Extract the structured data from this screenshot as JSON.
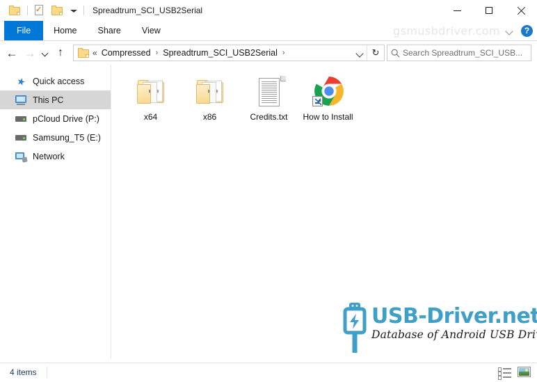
{
  "window": {
    "title": "Spreadtrum_SCI_USB2Serial",
    "quick_access": {
      "folder_icon": "folder-icon",
      "properties_icon": "properties-icon",
      "new_folder_icon": "new-folder-icon",
      "customize_icon": "customize-quick-access-icon"
    },
    "controls": {
      "minimize": "minimize-icon",
      "maximize": "maximize-icon",
      "close": "close-icon"
    }
  },
  "ribbon": {
    "tabs": [
      {
        "label": "File",
        "active": true
      },
      {
        "label": "Home",
        "active": false
      },
      {
        "label": "Share",
        "active": false
      },
      {
        "label": "View",
        "active": false
      }
    ],
    "watermark": "gsmusbdriver.com",
    "collapse_icon": "chevron-down-icon",
    "help_label": "?"
  },
  "navigation": {
    "back_icon": "←",
    "forward_icon": "→",
    "recent_icon": "chevron-down-icon",
    "up_icon": "↑",
    "refresh_icon": "↻",
    "address": {
      "folder_icon": "folder-icon",
      "overflow": "«",
      "crumbs": [
        "Compressed",
        "Spreadtrum_SCI_USB2Serial"
      ],
      "separator": "›",
      "trailing_separator": "›",
      "dropdown_icon": "chevron-down-icon"
    },
    "search": {
      "placeholder": "Search Spreadtrum_SCI_USB...",
      "icon": "search-icon"
    }
  },
  "sidebar": {
    "items": [
      {
        "label": "Quick access",
        "icon": "star-icon",
        "selected": false
      },
      {
        "label": "This PC",
        "icon": "computer-icon",
        "selected": true
      },
      {
        "label": "pCloud Drive (P:)",
        "icon": "drive-icon",
        "selected": false
      },
      {
        "label": "Samsung_T5 (E:)",
        "icon": "drive-icon",
        "selected": false
      },
      {
        "label": "Network",
        "icon": "network-icon",
        "selected": false
      }
    ]
  },
  "files": [
    {
      "name": "x64",
      "type": "folder"
    },
    {
      "name": "x86",
      "type": "folder"
    },
    {
      "name": "Credits.txt",
      "type": "text-file"
    },
    {
      "name": "How to Install",
      "type": "chrome-shortcut"
    }
  ],
  "logo_watermark": {
    "main": "USB-Driver.net",
    "tagline": "Database of Android USB Driver",
    "icon": "usb-plug-icon",
    "color": "#3f9fc6"
  },
  "statusbar": {
    "item_count": "4 items",
    "views": [
      {
        "name": "details-view",
        "active": false
      },
      {
        "name": "large-icons-view",
        "active": true
      }
    ]
  },
  "colors": {
    "accent": "#0078d7",
    "selection": "#d6d6d6",
    "folder": "#fbdf9c",
    "logo": "#3f9fc6"
  }
}
